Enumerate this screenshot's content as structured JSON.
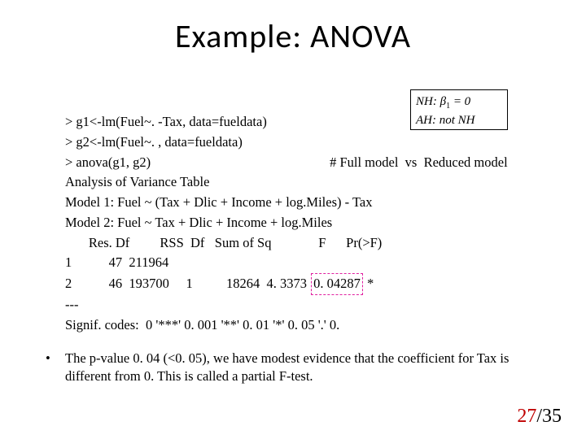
{
  "title": "Example:  ANOVA",
  "hypotheses": {
    "nh_label": "NH",
    "nh_body": ": β",
    "nh_sub": "1",
    "nh_tail": " = 0",
    "ah_label": "AH",
    "ah_body": ": not  NH"
  },
  "code": {
    "l1": "> g1<-lm(Fuel~. -Tax, data=fueldata)",
    "l2": "> g2<-lm(Fuel~. , data=fueldata)",
    "l3a": "> anova(g1, g2)",
    "l3b": "# Full model  vs  Reduced model",
    "l4": "Analysis of Variance Table",
    "l5": "Model 1: Fuel ~ (Tax + Dlic + Income + log.Miles) - Tax",
    "l6": "Model 2: Fuel ~ Tax + Dlic + Income + log.Miles",
    "l7": "       Res. Df         RSS  Df   Sum of Sq              F      Pr(>F)",
    "l8": "1           47  211964",
    "l9a": "2           46  193700     1          18264  4. 3373 ",
    "l9_pval": "0. 04287",
    "l9b": " *",
    "l10": "---",
    "l11": "Signif. codes:  0 '***' 0. 001 '**' 0. 01 '*' 0. 05 '.' 0."
  },
  "bullet": "The p-value 0. 04 (<0. 05), we have modest evidence that the coefficient for Tax is different from 0. This is called a partial F-test.",
  "page": {
    "current": "27",
    "total": "35"
  },
  "chart_data": {
    "type": "table",
    "title": "Analysis of Variance Table",
    "columns": [
      "Model",
      "Res.Df",
      "RSS",
      "Df",
      "Sum of Sq",
      "F",
      "Pr(>F)"
    ],
    "rows": [
      {
        "Model": 1,
        "Res.Df": 47,
        "RSS": 211964,
        "Df": null,
        "Sum of Sq": null,
        "F": null,
        "Pr(>F)": null
      },
      {
        "Model": 2,
        "Res.Df": 46,
        "RSS": 193700,
        "Df": 1,
        "Sum of Sq": 18264,
        "F": 4.3373,
        "Pr(>F)": 0.04287
      }
    ],
    "models": [
      "Fuel ~ (Tax + Dlic + Income + log.Miles) - Tax",
      "Fuel ~ Tax + Dlic + Income + log.Miles"
    ],
    "signif_codes": "0 '***' 0.001 '**' 0.01 '*' 0.05 '.' 0."
  }
}
